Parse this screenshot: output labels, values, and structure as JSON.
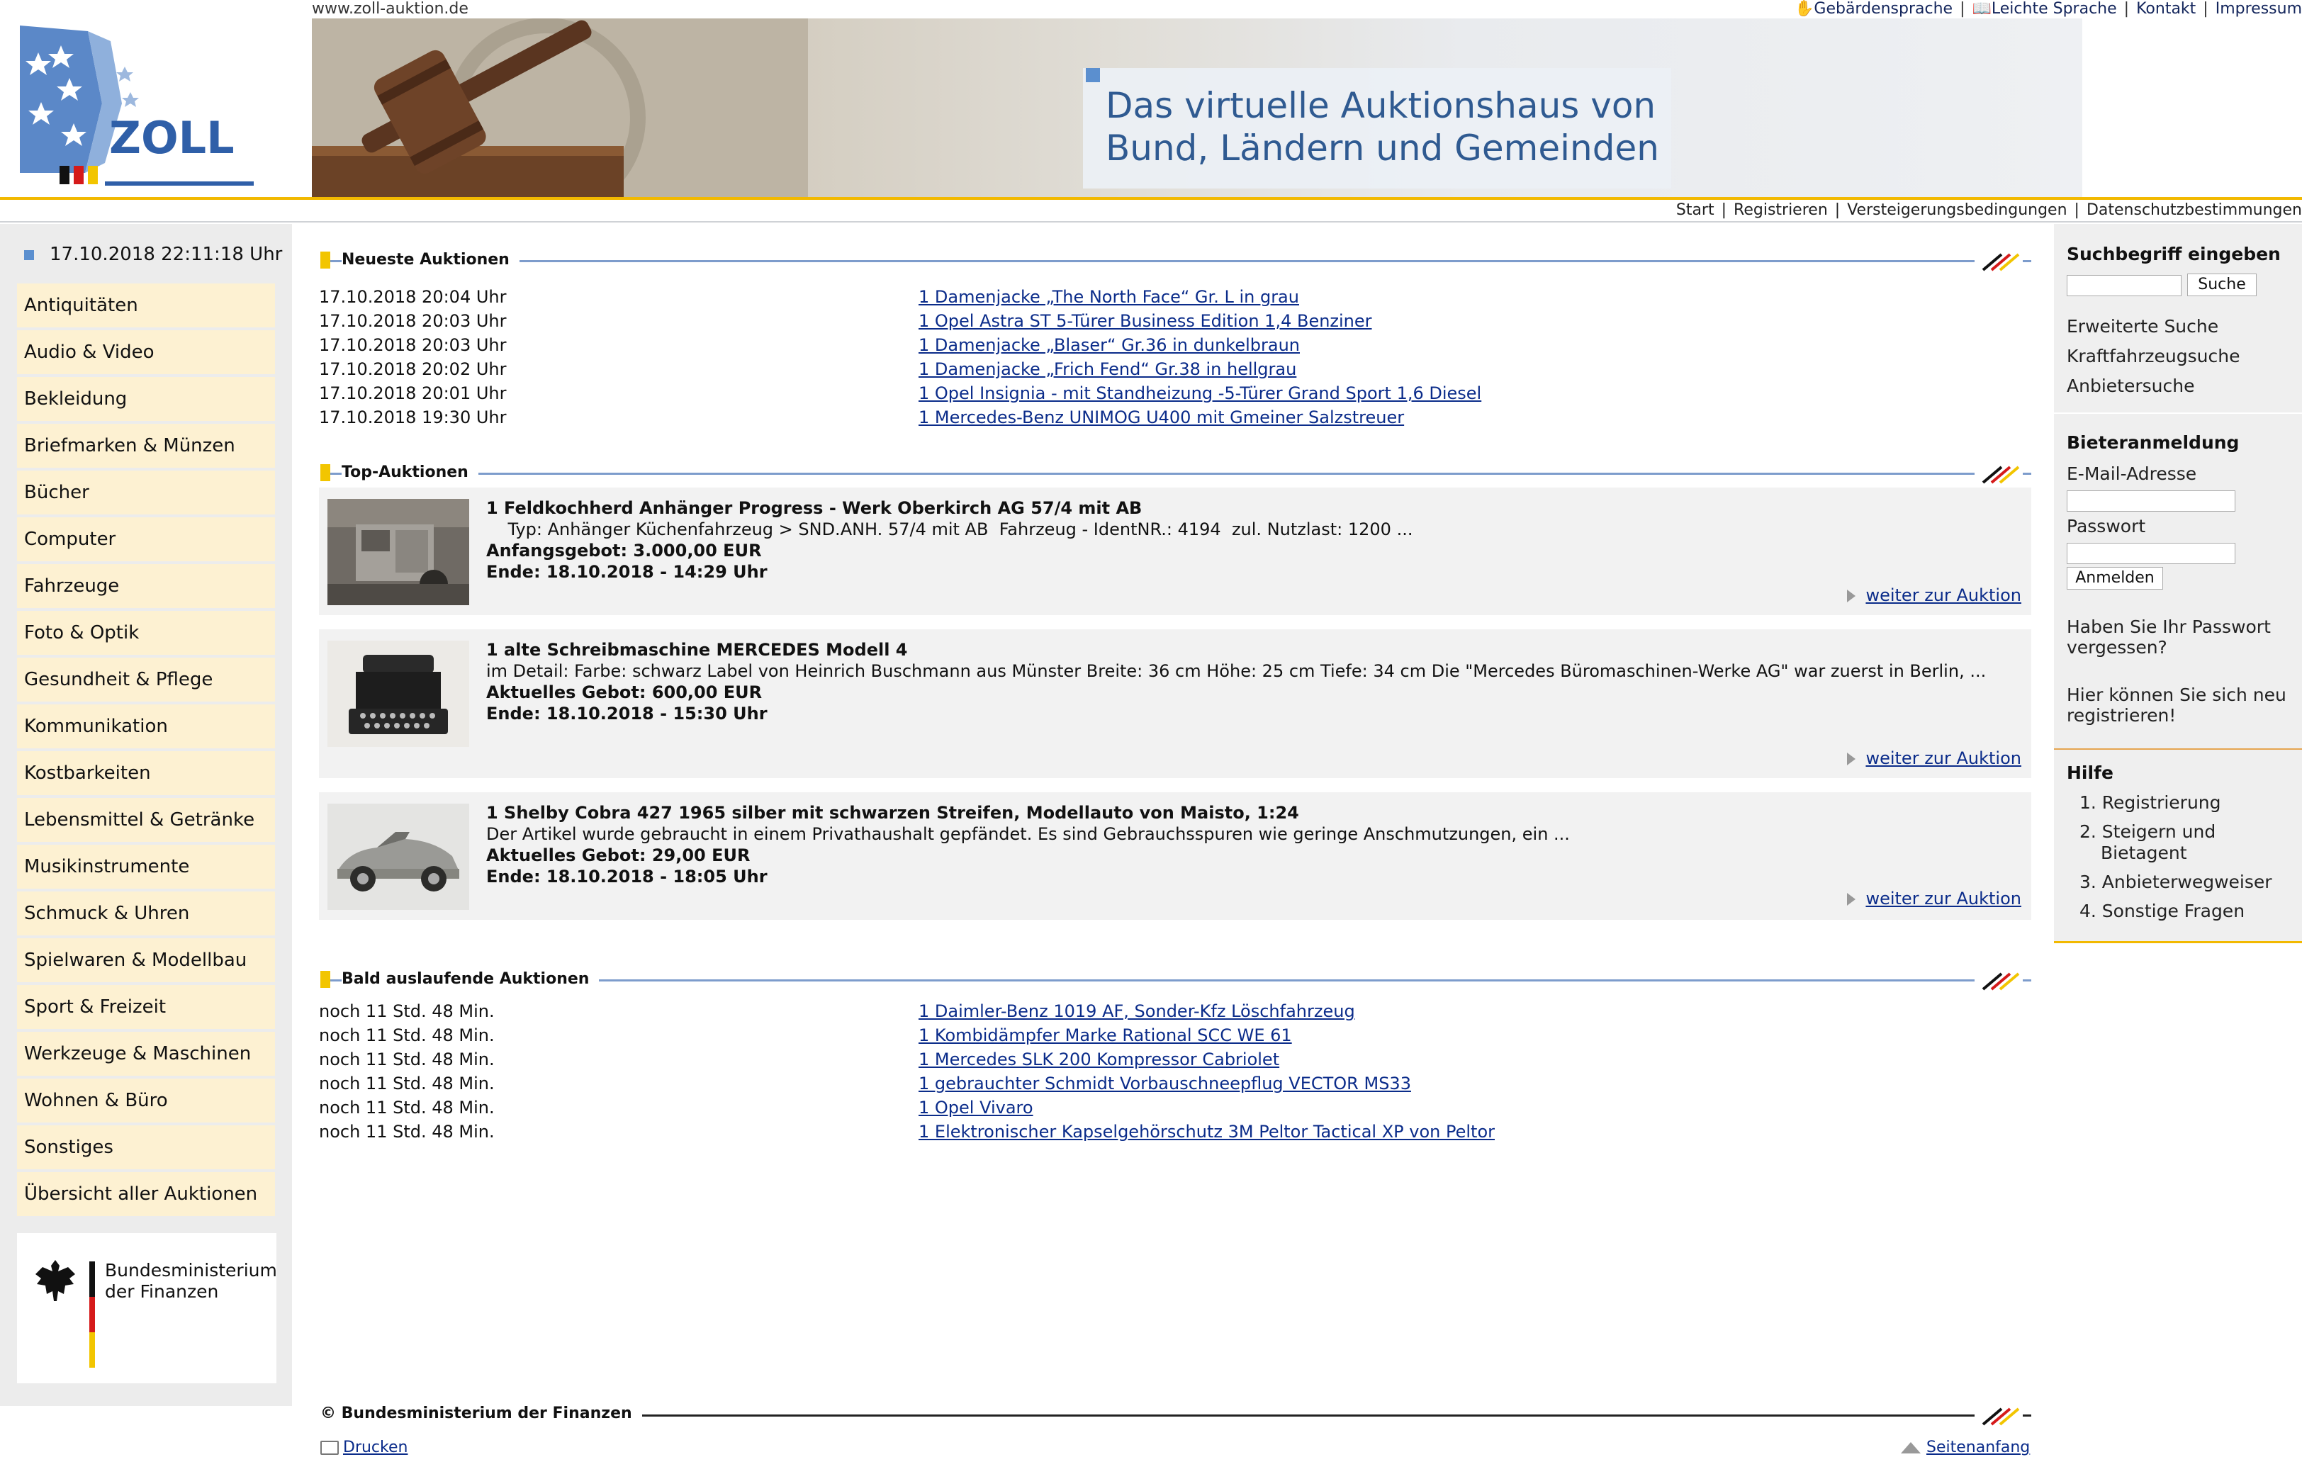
{
  "header": {
    "site_url": "www.zoll-auktion.de",
    "logo_text": "ZOLL",
    "top_links": [
      "Gebärdensprache",
      "Leichte Sprache",
      "Kontakt",
      "Impressum"
    ],
    "banner_line1": "Das virtuelle Auktionshaus von",
    "banner_line2": "Bund, Ländern und Gemeinden",
    "sub_nav": [
      "Start",
      "Registrieren",
      "Versteigerungsbedingungen",
      "Datenschutzbestimmungen"
    ]
  },
  "sidebar": {
    "datetime": "17.10.2018 22:11:18 Uhr",
    "categories": [
      "Antiquitäten",
      "Audio & Video",
      "Bekleidung",
      "Briefmarken & Münzen",
      "Bücher",
      "Computer",
      "Fahrzeuge",
      "Foto & Optik",
      "Gesundheit & Pflege",
      "Kommunikation",
      "Kostbarkeiten",
      "Lebensmittel & Getränke",
      "Musikinstrumente",
      "Schmuck & Uhren",
      "Spielwaren & Modellbau",
      "Sport & Freizeit",
      "Werkzeuge & Maschinen",
      "Wohnen & Büro",
      "Sonstiges",
      "Übersicht aller Auktionen"
    ],
    "ministry_line1": "Bundesministerium",
    "ministry_line2": "der Finanzen"
  },
  "newest": {
    "title": "Neueste Auktionen",
    "rows": [
      {
        "time": "17.10.2018 20:04 Uhr",
        "item": "1 Damenjacke „The North Face“ Gr. L in grau"
      },
      {
        "time": "17.10.2018 20:03 Uhr",
        "item": "1 Opel Astra ST 5-Türer Business Edition 1,4 Benziner"
      },
      {
        "time": "17.10.2018 20:03 Uhr",
        "item": "1 Damenjacke „Blaser“ Gr.36 in dunkelbraun"
      },
      {
        "time": "17.10.2018 20:02 Uhr",
        "item": "1 Damenjacke „Frich Fend“ Gr.38 in hellgrau"
      },
      {
        "time": "17.10.2018 20:01 Uhr",
        "item": "1 Opel Insignia - mit Standheizung -5-Türer Grand Sport 1,6 Diesel"
      },
      {
        "time": "17.10.2018 19:30 Uhr",
        "item": "1 Mercedes-Benz UNIMOG U400 mit Gmeiner Salzstreuer"
      }
    ]
  },
  "top": {
    "title": "Top-Auktionen",
    "more_label": "weiter zur Auktion",
    "cards": [
      {
        "title": "1 Feldkochherd Anhänger Progress - Werk Oberkirch AG 57/4 mit AB",
        "desc": "    Typ: Anhänger Küchenfahrzeug > SND.ANH. 57/4 mit AB  Fahrzeug - IdentNR.: 4194  zul. Nutzlast: 1200 ...",
        "price": "Anfangsgebot: 3.000,00 EUR",
        "end": "Ende: 18.10.2018 - 14:29 Uhr"
      },
      {
        "title": "1 alte Schreibmaschine MERCEDES Modell 4",
        "desc": "im Detail:   Farbe: schwarz Label von Heinrich Buschmann aus Münster Breite: 36 cm Höhe: 25 cm Tiefe: 34 cm  Die \"Mercedes Büromaschinen-Werke AG\" war zuerst in Berlin, ...",
        "price": "Aktuelles Gebot: 600,00 EUR",
        "end": "Ende: 18.10.2018 - 15:30 Uhr"
      },
      {
        "title": "1 Shelby Cobra 427 1965 silber mit schwarzen Streifen, Modellauto von Maisto, 1:24",
        "desc": "Der Artikel wurde gebraucht in einem Privathaushalt gepfändet. Es sind Gebrauchsspuren wie geringe Anschmutzungen, ein ...",
        "price": "Aktuelles Gebot: 29,00 EUR",
        "end": "Ende: 18.10.2018 - 18:05 Uhr"
      }
    ]
  },
  "ending": {
    "title": "Bald auslaufende Auktionen",
    "rows": [
      {
        "time": "noch 11 Std. 48 Min.",
        "item": "1 Daimler-Benz 1019 AF, Sonder-Kfz Löschfahrzeug"
      },
      {
        "time": "noch 11 Std. 48 Min.",
        "item": "1 Kombidämpfer Marke Rational SCC WE 61"
      },
      {
        "time": "noch 11 Std. 48 Min.",
        "item": "1 Mercedes SLK 200 Kompressor Cabriolet"
      },
      {
        "time": "noch 11 Std. 48 Min.",
        "item": "1 gebrauchter Schmidt Vorbauschneepflug VECTOR MS33"
      },
      {
        "time": "noch 11 Std. 48 Min.",
        "item": "1 Opel Vivaro"
      },
      {
        "time": "noch 11 Std. 48 Min.",
        "item": "1 Elektronischer Kapselgehörschutz 3M Peltor Tactical XP von Peltor"
      }
    ]
  },
  "right": {
    "search_heading": "Suchbegriff eingeben",
    "search_button": "Suche",
    "search_links": [
      "Erweiterte Suche",
      "Kraftfahrzeugsuche",
      "Anbietersuche"
    ],
    "login_heading": "Bieteranmeldung",
    "email_label": "E-Mail-Adresse",
    "password_label": "Passwort",
    "login_button": "Anmelden",
    "forgot_line1": "Haben Sie Ihr Passwort",
    "forgot_line2": "vergessen?",
    "register_line1": "Hier können Sie sich neu",
    "register_line2": "registrieren!",
    "help_heading": "Hilfe",
    "help_items": [
      "1. Registrierung",
      "2. Steigern und",
      "Bietagent",
      "3. Anbieterwegweiser",
      "4. Sonstige Fragen"
    ]
  },
  "footer": {
    "copyright": "© Bundesministerium der Finanzen",
    "print_label": "Drucken",
    "top_label": "Seitenanfang"
  },
  "colors": {
    "accent_yellow": "#f2c500",
    "link_blue": "#0b2c8a",
    "category_bg": "#fdf1d2"
  }
}
